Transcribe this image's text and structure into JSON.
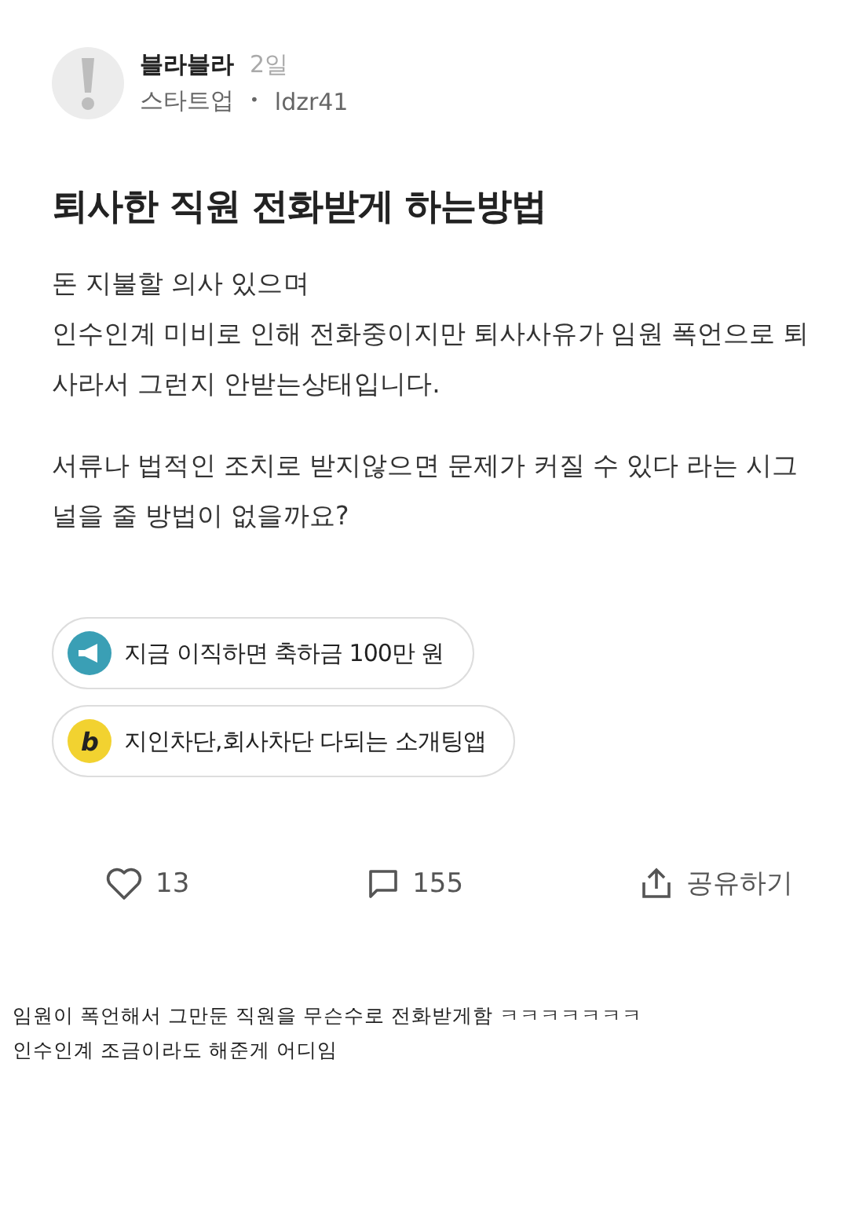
{
  "post": {
    "author": "블라블라",
    "time": "2일",
    "company": "스타트업",
    "separator": "•",
    "user_id": "ldzr41",
    "title": "퇴사한 직원 전화받게 하는방법",
    "paragraphs": [
      "돈 지불할 의사 있으며\n인수인계 미비로 인해 전화중이지만 퇴사사유가 임원 폭언으로 퇴사라서 그런지 안받는상태입니다.",
      "서류나 법적인 조치로 받지않으면 문제가 커질 수 있다 라는 시그널을 줄 방법이 없을까요?"
    ]
  },
  "ads": [
    {
      "kind": "megaphone",
      "color": "#3a9fb5",
      "text": "지금 이직하면 축하금 100만 원"
    },
    {
      "kind": "letter",
      "color": "#f2d230",
      "icon_text": "b",
      "text": "지인차단,회사차단 다되는 소개팅앱"
    }
  ],
  "actions": [
    {
      "kind": "like",
      "label": "13"
    },
    {
      "kind": "comment",
      "label": "155"
    },
    {
      "kind": "share",
      "label": "공유하기"
    }
  ],
  "caption": [
    "임원이 폭언해서 그만둔 직원을 무슨수로 전화받게함 ㅋㅋㅋㅋㅋㅋㅋ",
    "인수인계 조금이라도 해준게 어디임"
  ]
}
